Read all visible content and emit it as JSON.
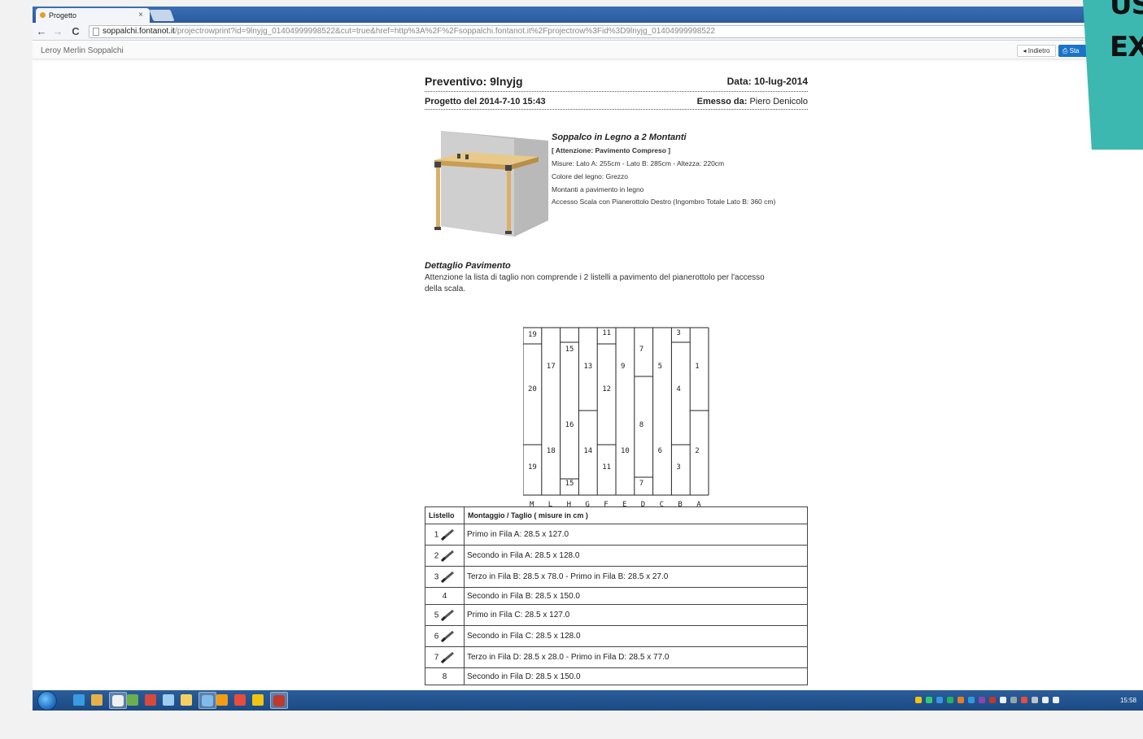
{
  "browser": {
    "tab_title": "Progetto",
    "tab_close": "×",
    "url_host": "soppalchi.fontanot.it",
    "url_path": "/projectrowprint?id=9lnyjg_01404999998522&cut=true&href=http%3A%2F%2Fsoppalchi.fontanot.it%2Fprojectrow%3Fid%3D9lnyjg_01404999998522",
    "back_glyph": "←",
    "forward_glyph": "→",
    "reload_glyph": "C"
  },
  "appbar": {
    "brand": "Leroy Merlin Soppalchi",
    "back_label": "◂ Indietro",
    "print_label": "⎙ Sta"
  },
  "overlay": {
    "line1": "US",
    "line2": "EX"
  },
  "document": {
    "preventivo_label": "Preventivo: 9lnyjg",
    "data_label": "Data: 10-lug-2014",
    "progetto_label": "Progetto del 2014-7-10 15:43",
    "emesso_label": "Emesso da:",
    "emesso_value": "Piero Denicolo",
    "product": {
      "title": "Soppalco in Legno a 2 Montanti",
      "warning": "[ Attenzione: Pavimento Compreso ]",
      "specs": [
        "Misure: Lato A: 255cm - Lato B: 285cm - Altezza: 220cm",
        "Colore del legno: Grezzo",
        "Montanti a pavimento in legno",
        "Accesso Scala con Pianerottolo Destro (Ingombro Totale Lato B: 360 cm)"
      ]
    },
    "section_title": "Dettaglio Pavimento",
    "section_note": "Attenzione la lista di taglio non comprende i 2 listelli a pavimento del pianerottolo per l'accesso della scala.",
    "diagram": {
      "column_letters": [
        "M",
        "L",
        "H",
        "G",
        "F",
        "E",
        "D",
        "C",
        "B",
        "A"
      ],
      "labels": [
        "19",
        "17",
        "15",
        "13",
        "11",
        "9",
        "7",
        "5",
        "3",
        "1",
        "20",
        "12",
        "4",
        "16",
        "8",
        "18",
        "14",
        "10",
        "6",
        "2",
        "19",
        "11",
        "3",
        "15",
        "7"
      ]
    },
    "table": {
      "headers": [
        "Listello",
        "Montaggio / Taglio ( misure in cm )"
      ],
      "rows": [
        {
          "n": "1",
          "text": "Primo in Fila A: 28.5 x 127.0"
        },
        {
          "n": "2",
          "text": "Secondo in Fila A: 28.5 x 128.0"
        },
        {
          "n": "3",
          "text": "Terzo in Fila B: 28.5 x 78.0 - Primo in Fila B: 28.5 x 27.0"
        },
        {
          "n": "4",
          "text": "Secondo in Fila B: 28.5 x 150.0"
        },
        {
          "n": "5",
          "text": "Primo in Fila C: 28.5 x 127.0"
        },
        {
          "n": "6",
          "text": "Secondo in Fila C: 28.5 x 128.0"
        },
        {
          "n": "7",
          "text": "Terzo in Fila D: 28.5 x 28.0 - Primo in Fila D: 28.5 x 77.0"
        },
        {
          "n": "8",
          "text": "Secondo in Fila D: 28.5 x 150.0"
        }
      ]
    }
  },
  "taskbar": {
    "clock": "15:58"
  },
  "colors": {
    "taskbar": "#1c4a83",
    "accent_button": "#1a73c9",
    "overlay": "#3cb8b1"
  }
}
